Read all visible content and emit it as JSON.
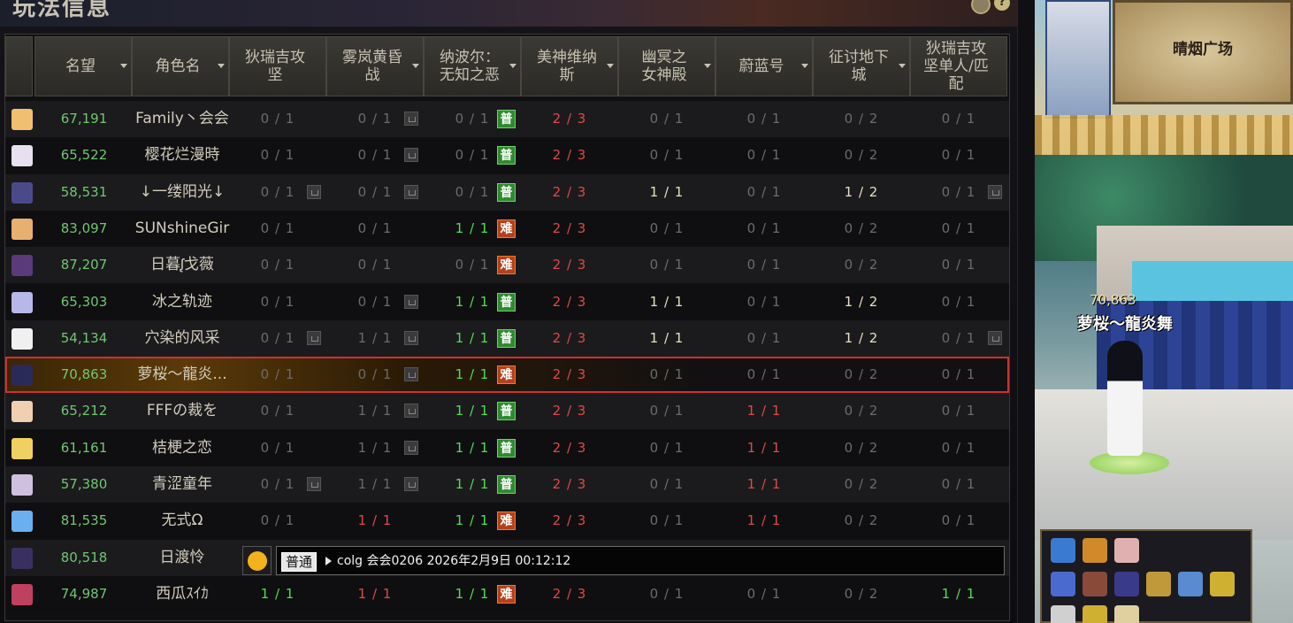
{
  "panel": {
    "title": "玩法信息"
  },
  "columns": [
    {
      "label": "",
      "sortable": false
    },
    {
      "label": "名望",
      "sortable": true
    },
    {
      "label": "角色名",
      "sortable": true
    },
    {
      "label": "狄瑞吉攻\n坚",
      "sortable": false
    },
    {
      "label": "雾岚黄昏\n战",
      "sortable": true
    },
    {
      "label": "纳波尔：\n无知之恶",
      "sortable": true
    },
    {
      "label": "美神维纳\n斯",
      "sortable": true
    },
    {
      "label": "幽冥之\n女神殿",
      "sortable": true
    },
    {
      "label": "蔚蓝号",
      "sortable": true
    },
    {
      "label": "征讨地下\n城",
      "sortable": true
    },
    {
      "label": "狄瑞吉攻\n坚单人/匹\n配",
      "sortable": false
    }
  ],
  "rows": [
    {
      "fame": "67,191",
      "name": "Family丶会会",
      "avatar": "#f0c070",
      "cells": [
        {
          "t": "0 / 1",
          "c": "gray"
        },
        {
          "t": "0 / 1",
          "c": "gray",
          "lock": true
        },
        {
          "t": "0 / 1",
          "c": "gray",
          "badge": "普"
        },
        {
          "t": "2 / 3",
          "c": "red"
        },
        {
          "t": "0 / 1",
          "c": "gray"
        },
        {
          "t": "0 / 1",
          "c": "gray"
        },
        {
          "t": "0 / 2",
          "c": "gray"
        },
        {
          "t": "0 / 1",
          "c": "gray"
        }
      ]
    },
    {
      "fame": "65,522",
      "name": "樱花烂漫時",
      "avatar": "#e8e0f0",
      "cells": [
        {
          "t": "0 / 1",
          "c": "gray"
        },
        {
          "t": "0 / 1",
          "c": "gray",
          "lock": true
        },
        {
          "t": "0 / 1",
          "c": "gray",
          "badge": "普"
        },
        {
          "t": "2 / 3",
          "c": "red"
        },
        {
          "t": "0 / 1",
          "c": "gray"
        },
        {
          "t": "0 / 1",
          "c": "gray"
        },
        {
          "t": "0 / 2",
          "c": "gray"
        },
        {
          "t": "0 / 1",
          "c": "gray"
        }
      ]
    },
    {
      "fame": "58,531",
      "name": "↓一缕阳光↓",
      "avatar": "#4a4a8a",
      "cells": [
        {
          "t": "0 / 1",
          "c": "gray",
          "lock": true
        },
        {
          "t": "0 / 1",
          "c": "gray",
          "lock": true
        },
        {
          "t": "0 / 1",
          "c": "gray",
          "badge": "普"
        },
        {
          "t": "2 / 3",
          "c": "red"
        },
        {
          "t": "1 / 1",
          "c": "yellow"
        },
        {
          "t": "0 / 1",
          "c": "gray"
        },
        {
          "t": "1 / 2",
          "c": "yellow"
        },
        {
          "t": "0 / 1",
          "c": "gray",
          "lock": true
        }
      ]
    },
    {
      "fame": "83,097",
      "name": "SUNshineGir",
      "avatar": "#e8b070",
      "cells": [
        {
          "t": "0 / 1",
          "c": "gray"
        },
        {
          "t": "0 / 1",
          "c": "gray"
        },
        {
          "t": "1 / 1",
          "c": "green",
          "badge": "难"
        },
        {
          "t": "2 / 3",
          "c": "red"
        },
        {
          "t": "0 / 1",
          "c": "gray"
        },
        {
          "t": "0 / 1",
          "c": "gray"
        },
        {
          "t": "0 / 2",
          "c": "gray"
        },
        {
          "t": "0 / 1",
          "c": "gray"
        }
      ]
    },
    {
      "fame": "87,207",
      "name": "日暮ᶘ戈薇",
      "avatar": "#5a3a7a",
      "cells": [
        {
          "t": "0 / 1",
          "c": "gray"
        },
        {
          "t": "0 / 1",
          "c": "gray"
        },
        {
          "t": "0 / 1",
          "c": "gray",
          "badge": "难"
        },
        {
          "t": "2 / 3",
          "c": "red"
        },
        {
          "t": "0 / 1",
          "c": "gray"
        },
        {
          "t": "0 / 1",
          "c": "gray"
        },
        {
          "t": "0 / 2",
          "c": "gray"
        },
        {
          "t": "0 / 1",
          "c": "gray"
        }
      ]
    },
    {
      "fame": "65,303",
      "name": "冰之轨迹",
      "avatar": "#b8b8e8",
      "cells": [
        {
          "t": "0 / 1",
          "c": "gray"
        },
        {
          "t": "0 / 1",
          "c": "gray",
          "lock": true
        },
        {
          "t": "1 / 1",
          "c": "green",
          "badge": "普"
        },
        {
          "t": "2 / 3",
          "c": "red"
        },
        {
          "t": "1 / 1",
          "c": "yellow"
        },
        {
          "t": "0 / 1",
          "c": "gray"
        },
        {
          "t": "1 / 2",
          "c": "yellow"
        },
        {
          "t": "0 / 1",
          "c": "gray"
        }
      ]
    },
    {
      "fame": "54,134",
      "name": "穴染的风采",
      "avatar": "#f0f0f0",
      "cells": [
        {
          "t": "0 / 1",
          "c": "gray",
          "lock": true
        },
        {
          "t": "1 / 1",
          "c": "gray",
          "lock": true
        },
        {
          "t": "1 / 1",
          "c": "green",
          "badge": "普"
        },
        {
          "t": "2 / 3",
          "c": "red"
        },
        {
          "t": "1 / 1",
          "c": "yellow"
        },
        {
          "t": "0 / 1",
          "c": "gray"
        },
        {
          "t": "1 / 2",
          "c": "yellow"
        },
        {
          "t": "0 / 1",
          "c": "gray",
          "lock": true
        }
      ]
    },
    {
      "fame": "70,863",
      "name": "萝桜～龍炎...",
      "avatar": "#2a2a5a",
      "selected": true,
      "cells": [
        {
          "t": "0 / 1",
          "c": "gray"
        },
        {
          "t": "0 / 1",
          "c": "gray",
          "lock": true
        },
        {
          "t": "1 / 1",
          "c": "green",
          "badge": "难"
        },
        {
          "t": "2 / 3",
          "c": "red"
        },
        {
          "t": "0 / 1",
          "c": "gray"
        },
        {
          "t": "0 / 1",
          "c": "gray"
        },
        {
          "t": "0 / 2",
          "c": "gray"
        },
        {
          "t": "0 / 1",
          "c": "gray"
        }
      ]
    },
    {
      "fame": "65,212",
      "name": "FFFの裁を",
      "avatar": "#f0d0b0",
      "cells": [
        {
          "t": "0 / 1",
          "c": "gray"
        },
        {
          "t": "1 / 1",
          "c": "gray",
          "lock": true
        },
        {
          "t": "1 / 1",
          "c": "green",
          "badge": "普"
        },
        {
          "t": "2 / 3",
          "c": "red"
        },
        {
          "t": "0 / 1",
          "c": "gray"
        },
        {
          "t": "1 / 1",
          "c": "red"
        },
        {
          "t": "0 / 2",
          "c": "gray"
        },
        {
          "t": "0 / 1",
          "c": "gray"
        }
      ]
    },
    {
      "fame": "61,161",
      "name": "桔梗之恋",
      "avatar": "#f0d060",
      "cells": [
        {
          "t": "0 / 1",
          "c": "gray"
        },
        {
          "t": "1 / 1",
          "c": "gray",
          "lock": true
        },
        {
          "t": "1 / 1",
          "c": "green",
          "badge": "普"
        },
        {
          "t": "2 / 3",
          "c": "red"
        },
        {
          "t": "0 / 1",
          "c": "gray"
        },
        {
          "t": "1 / 1",
          "c": "red"
        },
        {
          "t": "0 / 2",
          "c": "gray"
        },
        {
          "t": "0 / 1",
          "c": "gray"
        }
      ]
    },
    {
      "fame": "57,380",
      "name": "青涩童年",
      "avatar": "#d0c0e0",
      "cells": [
        {
          "t": "0 / 1",
          "c": "gray",
          "lock": true
        },
        {
          "t": "1 / 1",
          "c": "gray",
          "lock": true
        },
        {
          "t": "1 / 1",
          "c": "green",
          "badge": "普"
        },
        {
          "t": "2 / 3",
          "c": "red"
        },
        {
          "t": "0 / 1",
          "c": "gray"
        },
        {
          "t": "1 / 1",
          "c": "red"
        },
        {
          "t": "0 / 2",
          "c": "gray"
        },
        {
          "t": "0 / 1",
          "c": "gray"
        }
      ]
    },
    {
      "fame": "81,535",
      "name": "无式Ω",
      "avatar": "#6ab0f0",
      "cells": [
        {
          "t": "0 / 1",
          "c": "gray"
        },
        {
          "t": "1 / 1",
          "c": "red"
        },
        {
          "t": "1 / 1",
          "c": "green",
          "badge": "难"
        },
        {
          "t": "2 / 3",
          "c": "red"
        },
        {
          "t": "0 / 1",
          "c": "gray"
        },
        {
          "t": "1 / 1",
          "c": "red"
        },
        {
          "t": "0 / 2",
          "c": "gray"
        },
        {
          "t": "0 / 1",
          "c": "gray"
        }
      ]
    },
    {
      "fame": "80,518",
      "name": "日渡怜",
      "avatar": "#3a3060",
      "chat": true,
      "cells": []
    },
    {
      "fame": "74,987",
      "name": "西瓜ｽｲｶ",
      "avatar": "#c04060",
      "cells": [
        {
          "t": "1 / 1",
          "c": "green"
        },
        {
          "t": "1 / 1",
          "c": "red"
        },
        {
          "t": "1 / 1",
          "c": "green",
          "badge": "难"
        },
        {
          "t": "2 / 3",
          "c": "red"
        },
        {
          "t": "0 / 1",
          "c": "gray"
        },
        {
          "t": "0 / 1",
          "c": "gray"
        },
        {
          "t": "0 / 2",
          "c": "gray"
        },
        {
          "t": "1 / 1",
          "c": "green"
        }
      ]
    }
  ],
  "chat": {
    "channel": "普通",
    "text": "colg 会会0206 2026年2月9日 00:12:12"
  },
  "scene": {
    "map_label": "晴烟广场",
    "player_fame": "70,863",
    "player_name": "萝桜～龍炎舞"
  },
  "colors": {
    "gray": "#6b6b6b",
    "green": "#4ee04e",
    "red": "#e04848",
    "yellow": "#e8dfc2",
    "fame": "#6fc76f",
    "selected_outline": "#d03030"
  }
}
